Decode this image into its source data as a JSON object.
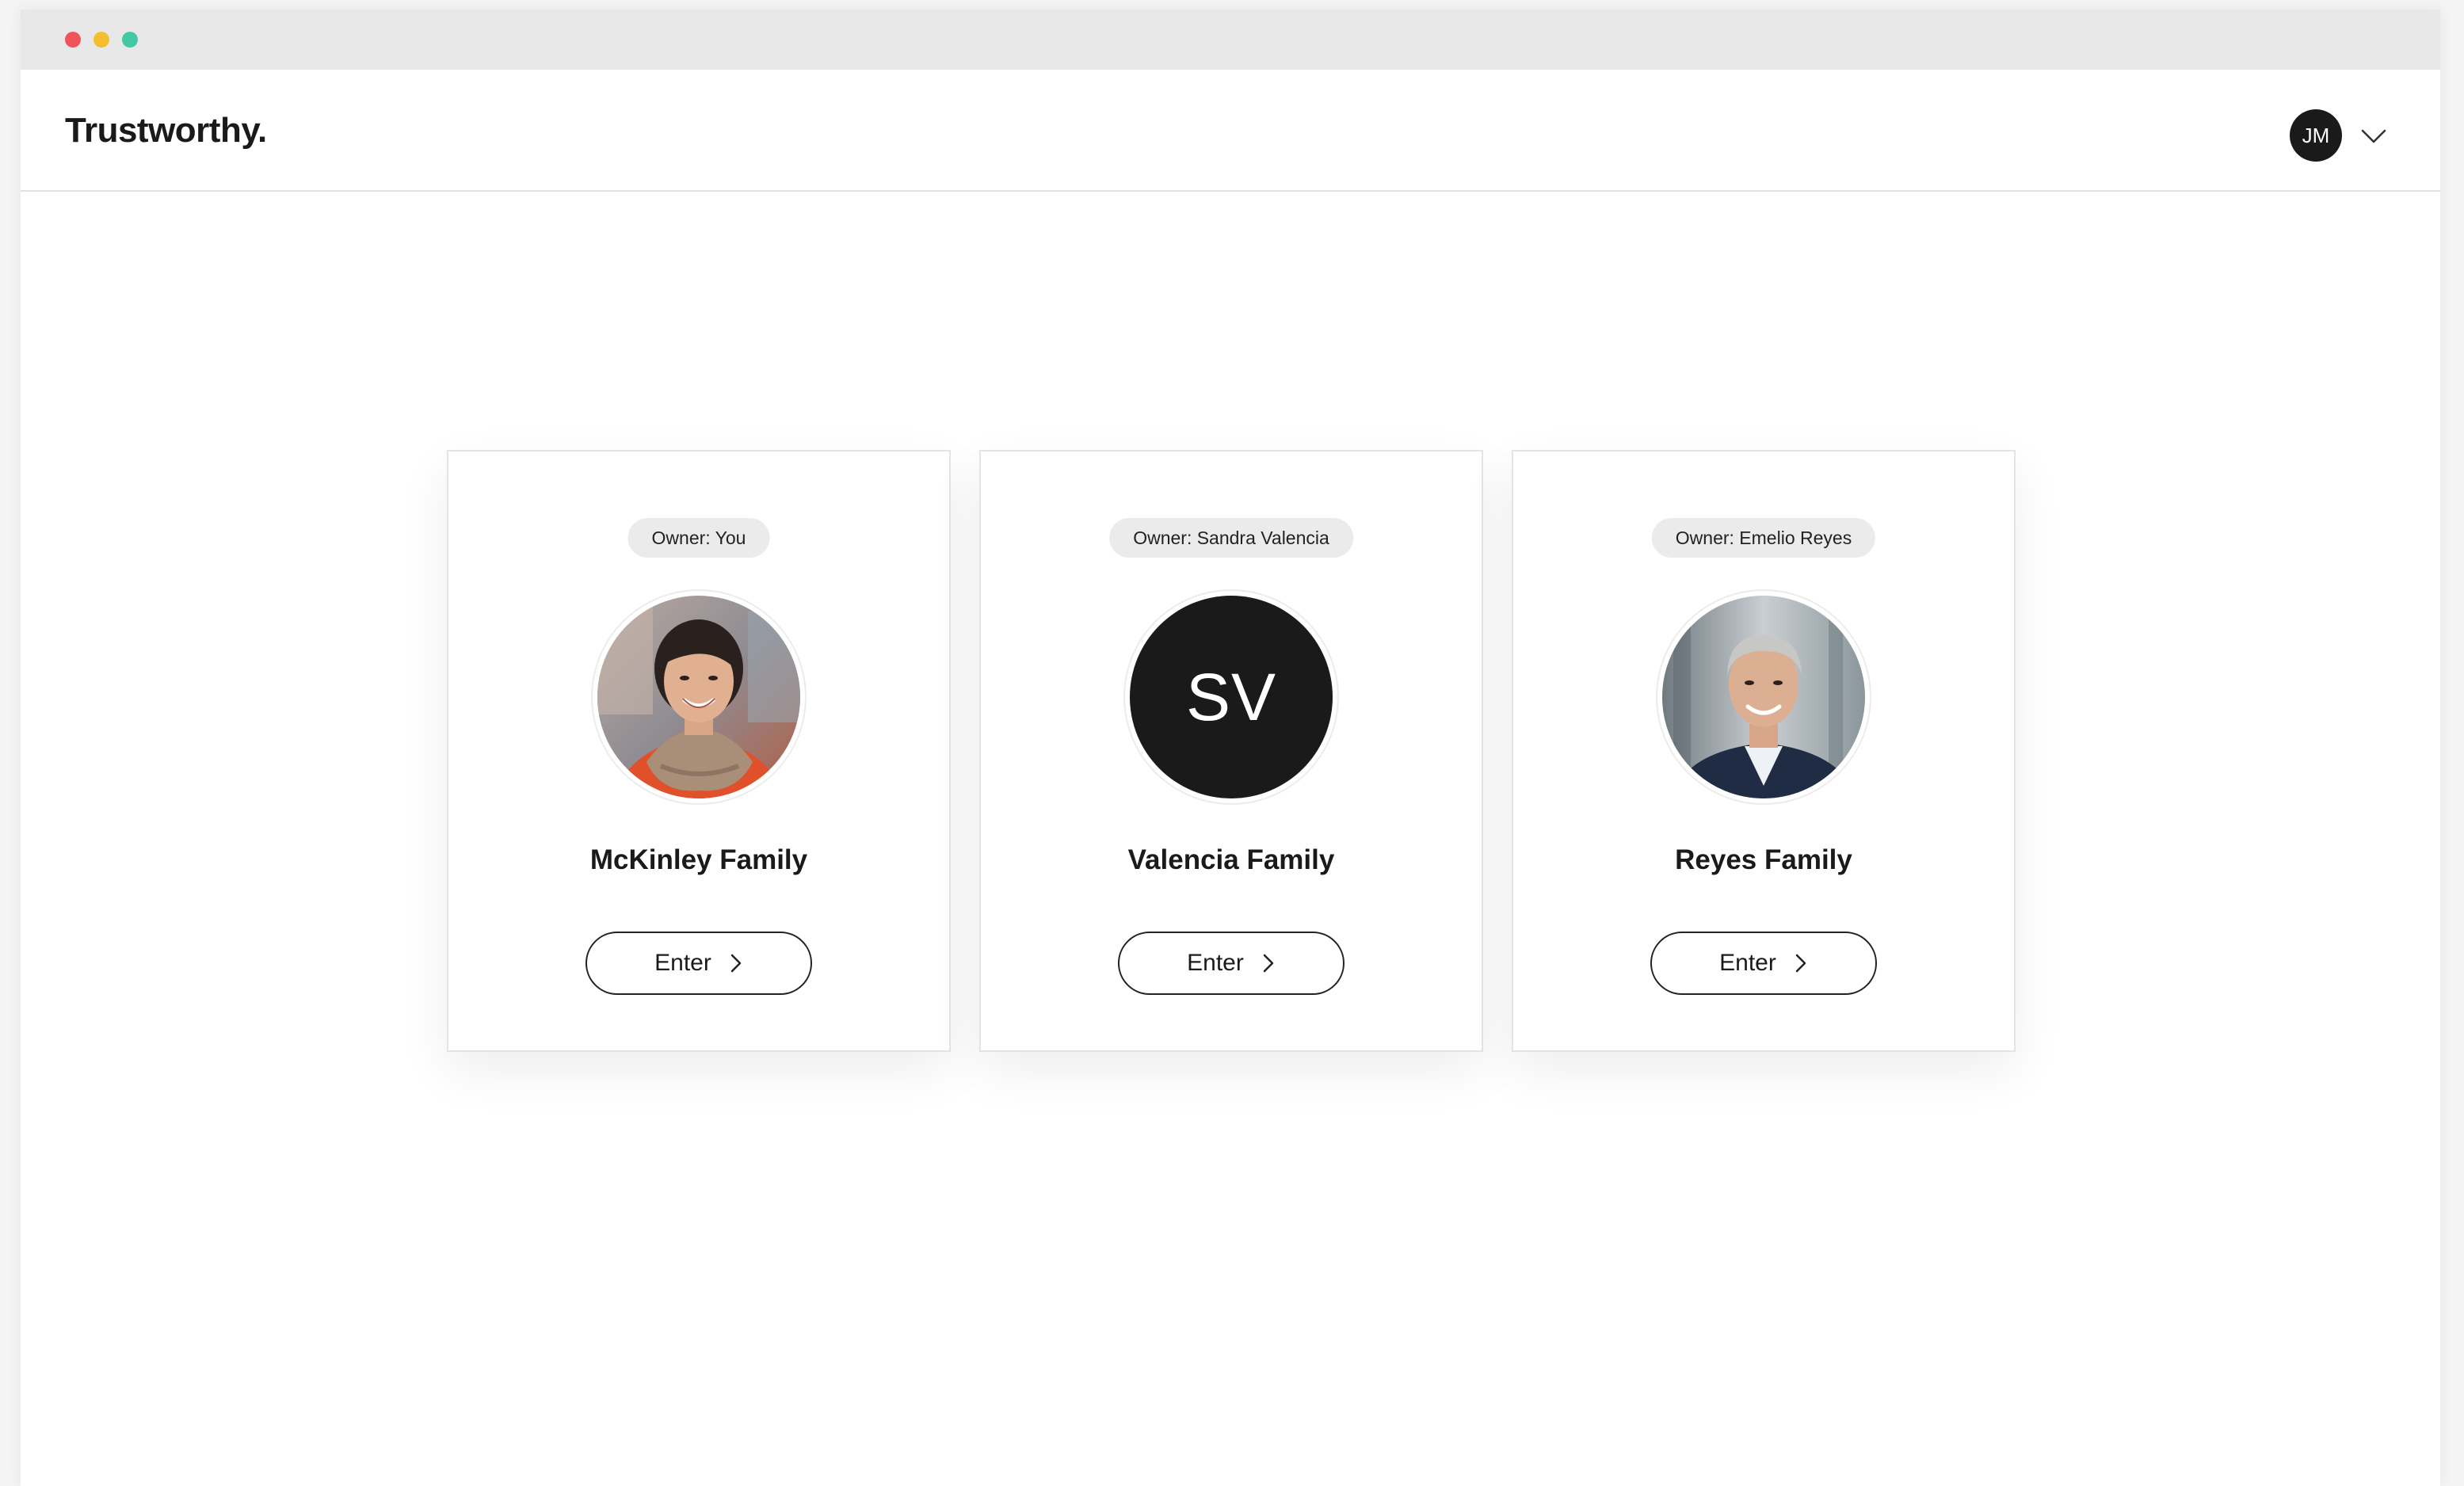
{
  "window": {
    "controls": [
      "close",
      "minimize",
      "maximize"
    ],
    "colors": {
      "close": "#f0545a",
      "minimize": "#f5bd30",
      "maximize": "#42c9a3"
    }
  },
  "header": {
    "logo": "Trustworthy.",
    "user_initials": "JM",
    "menu_icon": "chevron-down-icon"
  },
  "families": [
    {
      "owner": "Owner: You",
      "name": "McKinley Family",
      "avatar_type": "photo",
      "avatar_description": "portrait-woman-scarf",
      "enter_label": "Enter"
    },
    {
      "owner": "Owner: Sandra Valencia",
      "name": "Valencia Family",
      "avatar_type": "initials",
      "initials": "SV",
      "enter_label": "Enter"
    },
    {
      "owner": "Owner: Emelio Reyes",
      "name": "Reyes Family",
      "avatar_type": "photo",
      "avatar_description": "portrait-man-suit",
      "enter_label": "Enter"
    }
  ]
}
